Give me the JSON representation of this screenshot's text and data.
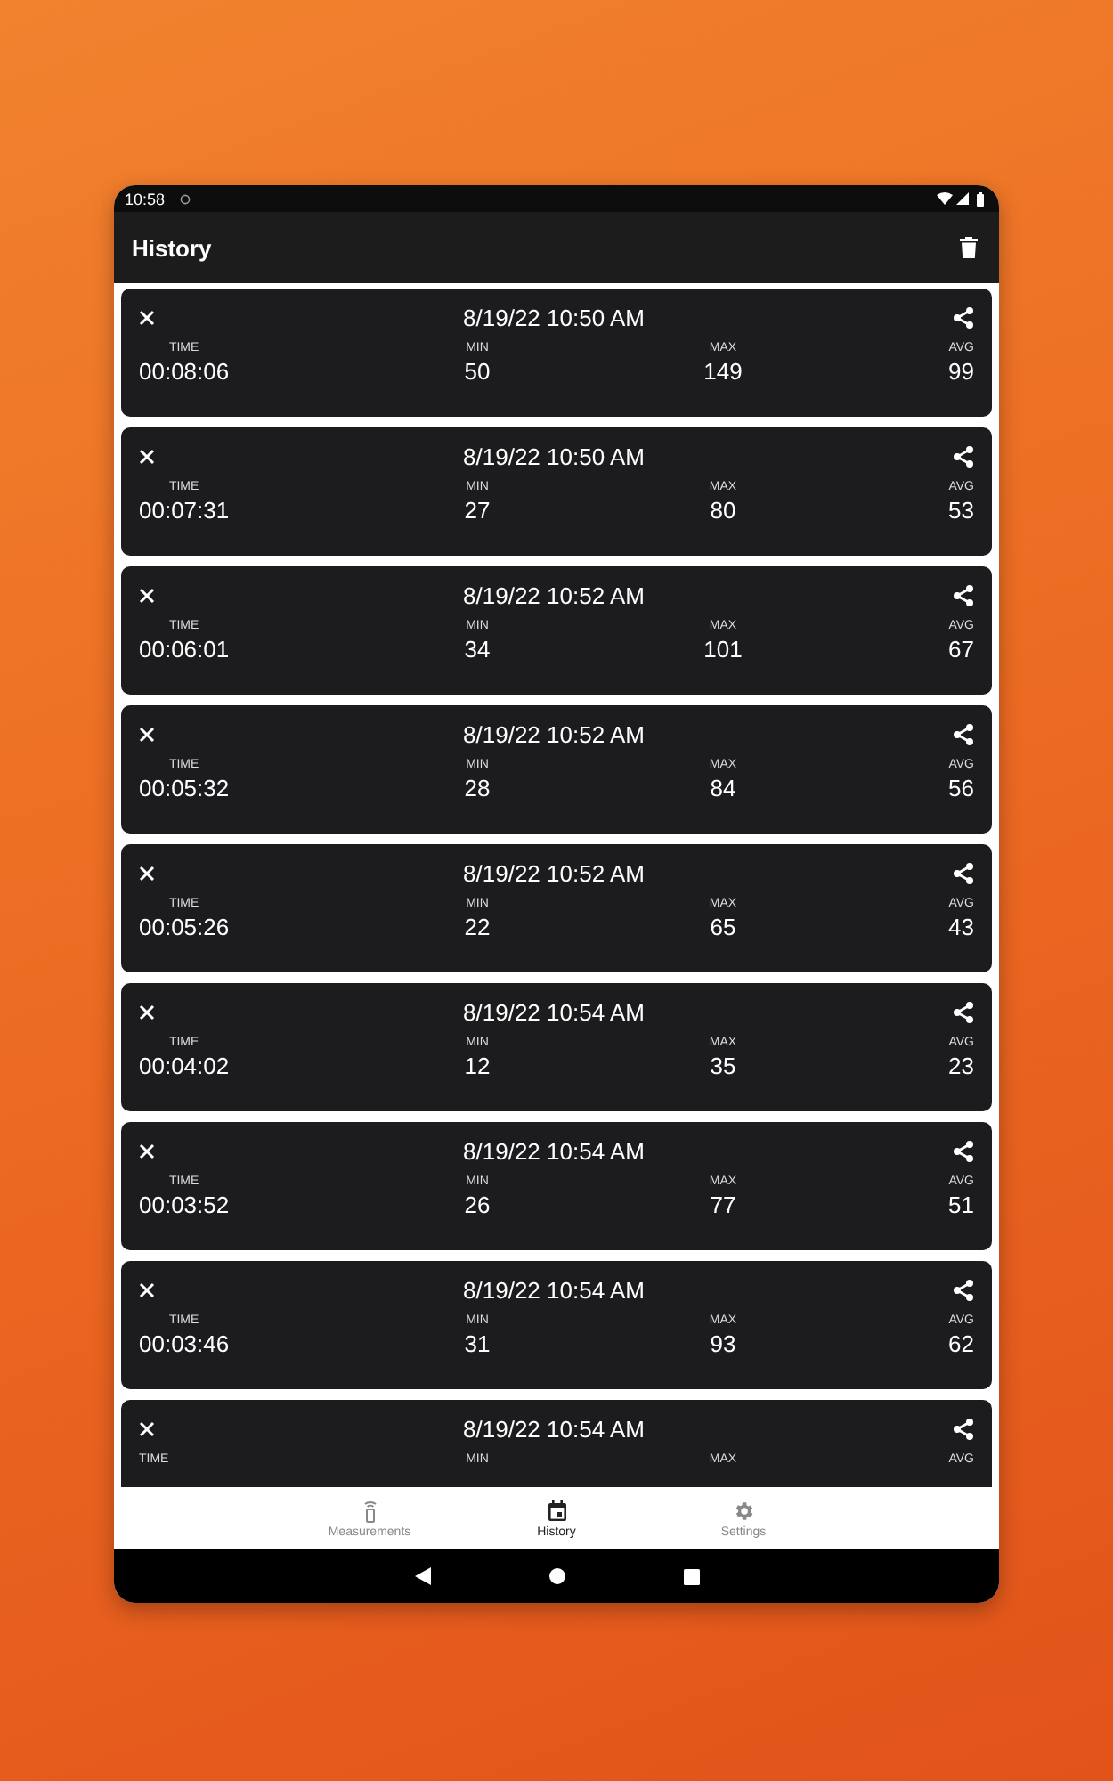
{
  "status_bar": {
    "time": "10:58"
  },
  "app_bar": {
    "title": "History"
  },
  "records": [
    {
      "date": "8/19/22 10:50 AM",
      "time_label": "TIME",
      "time": "00:08:06",
      "min_label": "MIN",
      "min": "50",
      "max_label": "MAX",
      "max": "149",
      "avg_label": "AVG",
      "avg": "99"
    },
    {
      "date": "8/19/22 10:50 AM",
      "time_label": "TIME",
      "time": "00:07:31",
      "min_label": "MIN",
      "min": "27",
      "max_label": "MAX",
      "max": "80",
      "avg_label": "AVG",
      "avg": "53"
    },
    {
      "date": "8/19/22 10:52 AM",
      "time_label": "TIME",
      "time": "00:06:01",
      "min_label": "MIN",
      "min": "34",
      "max_label": "MAX",
      "max": "101",
      "avg_label": "AVG",
      "avg": "67"
    },
    {
      "date": "8/19/22 10:52 AM",
      "time_label": "TIME",
      "time": "00:05:32",
      "min_label": "MIN",
      "min": "28",
      "max_label": "MAX",
      "max": "84",
      "avg_label": "AVG",
      "avg": "56"
    },
    {
      "date": "8/19/22 10:52 AM",
      "time_label": "TIME",
      "time": "00:05:26",
      "min_label": "MIN",
      "min": "22",
      "max_label": "MAX",
      "max": "65",
      "avg_label": "AVG",
      "avg": "43"
    },
    {
      "date": "8/19/22 10:54 AM",
      "time_label": "TIME",
      "time": "00:04:02",
      "min_label": "MIN",
      "min": "12",
      "max_label": "MAX",
      "max": "35",
      "avg_label": "AVG",
      "avg": "23"
    },
    {
      "date": "8/19/22 10:54 AM",
      "time_label": "TIME",
      "time": "00:03:52",
      "min_label": "MIN",
      "min": "26",
      "max_label": "MAX",
      "max": "77",
      "avg_label": "AVG",
      "avg": "51"
    },
    {
      "date": "8/19/22 10:54 AM",
      "time_label": "TIME",
      "time": "00:03:46",
      "min_label": "MIN",
      "min": "31",
      "max_label": "MAX",
      "max": "93",
      "avg_label": "AVG",
      "avg": "62"
    },
    {
      "date": "8/19/22 10:54 AM",
      "time_label": "TIME",
      "min_label": "MIN",
      "max_label": "MAX",
      "avg_label": "AVG"
    }
  ],
  "bottom_nav": [
    {
      "kind": "antenna",
      "label": "Measurements",
      "selected": false
    },
    {
      "kind": "calendar",
      "label": "History",
      "selected": true
    },
    {
      "kind": "gear",
      "label": "Settings",
      "selected": false
    }
  ]
}
